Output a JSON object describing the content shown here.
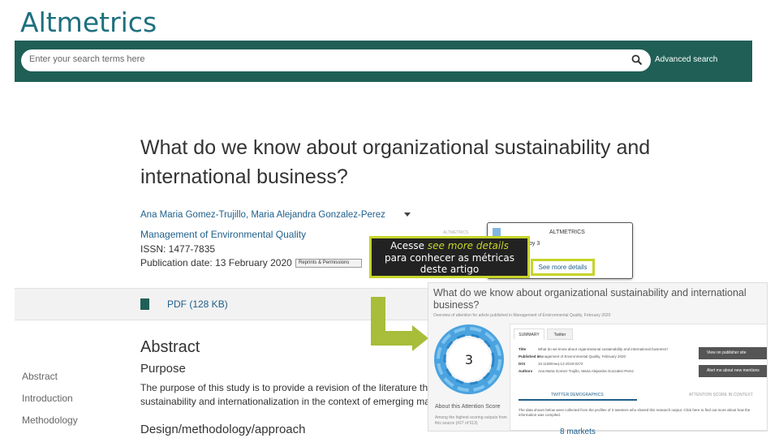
{
  "slide": {
    "title": "Altmetrics"
  },
  "header": {
    "search_placeholder": "Enter your search terms here",
    "advanced_search": "Advanced search",
    "brand_color": "#1f5f56"
  },
  "article": {
    "title": "What do we know about organizational sustainability and international business?",
    "authors": "Ana Maria Gomez-Trujillo, Maria Alejandra Gonzalez-Perez",
    "journal": "Management of Environmental Quality",
    "issn": "ISSN: 1477-7835",
    "pub_date": "Publication date: 13 February 2020",
    "reprints_button": "Reprints & Permissions",
    "pdf_link": "PDF (128 KB)",
    "abstract_heading": "Abstract",
    "purpose_heading": "Purpose",
    "purpose_text_line1": "The purpose of this study is to provide a revision of the literature tha",
    "purpose_text_line2": "sustainability and internationalization in the context of emerging ma",
    "design_heading": "Design/methodology/approach"
  },
  "side_nav": {
    "items": [
      "Abstract",
      "Introduction",
      "Methodology"
    ]
  },
  "altmetric_widget": {
    "small_label": "ALTMETRICS",
    "heading": "ALTMETRICS",
    "by_text": "by 3",
    "see_more": "See more details"
  },
  "callout": {
    "prefix": "Acesse",
    "highlight": "see more details",
    "line2": "para conhecer as métricas",
    "line3": "deste artigo"
  },
  "altmetric_details": {
    "title": "What do we know about organizational sustainability and international business?",
    "subtitle": "Overview of attention for article published in Management of Environmental Quality, February 2020",
    "score": "3",
    "about_score": "About this Attention Score",
    "score_blurb": "Among the highest-scoring outputs from this source (#27 of 513)",
    "tabs": [
      "SUMMARY",
      "Twitter"
    ],
    "meta": [
      {
        "key": "Title",
        "value": "What do we know about organizational sustainability and international business?"
      },
      {
        "key": "Published in",
        "value": "Management of Environmental Quality, February 2020"
      },
      {
        "key": "DOI",
        "value": "10.1108/meq-12-2019-0272"
      },
      {
        "key": "Authors",
        "value": "Ana Maria Gomez-Trujillo, Maria Alejandra Gonzalez-Perez"
      }
    ],
    "buttons": [
      "View on publisher site",
      "Alert me about new mentions"
    ],
    "section_tabs": [
      "TWITTER DEMOGRAPHICS",
      "ATTENTION SCORE IN CONTEXT"
    ],
    "demo_text": "The data shown below were collected from the profiles of 3 tweeters who shared this research output. Click here to find out more about how the information was compiled.",
    "markets": "8 markets"
  }
}
